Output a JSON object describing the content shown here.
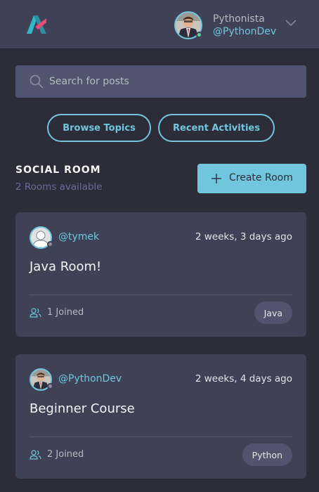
{
  "header": {
    "logo_icon": "logo-icon",
    "user": {
      "name": "Pythonista",
      "handle": "@PythonDev"
    },
    "menu_icon": "chevron-down-icon"
  },
  "search": {
    "placeholder": "Search for posts",
    "value": "",
    "icon": "search-icon"
  },
  "nav": {
    "browse_topics": "Browse Topics",
    "recent_activities": "Recent Activities"
  },
  "rooms_section": {
    "title": "SOCIAL ROOM",
    "subtitle": "2 Rooms available",
    "create_label": "Create Room",
    "create_icon": "plus-icon"
  },
  "rooms": [
    {
      "host": "@tymek",
      "time": "2 weeks, 3 days ago",
      "name": "Java Room!",
      "joined": "1 Joined",
      "topic": "Java"
    },
    {
      "host": "@PythonDev",
      "time": "2 weeks, 4 days ago",
      "name": "Beginner Course",
      "joined": "2 Joined",
      "topic": "Python"
    }
  ],
  "colors": {
    "background": "#2d2d39",
    "header": "#3f4156",
    "card": "#3f4156",
    "accent": "#71c6dd",
    "muted": "#696d97",
    "online": "#5dd693"
  }
}
